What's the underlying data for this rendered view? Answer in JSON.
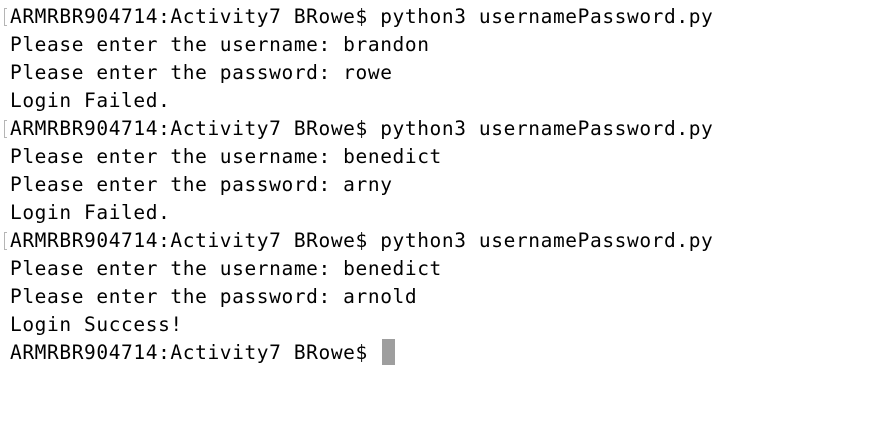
{
  "terminal": {
    "lines": [
      {
        "text": "ARMRBR904714:Activity7 BRowe$ python3 usernamePassword.py",
        "marked": true
      },
      {
        "text": "Please enter the username: brandon",
        "marked": false
      },
      {
        "text": "Please enter the password: rowe",
        "marked": false
      },
      {
        "text": "Login Failed.",
        "marked": false
      },
      {
        "text": "ARMRBR904714:Activity7 BRowe$ python3 usernamePassword.py",
        "marked": true
      },
      {
        "text": "Please enter the username: benedict",
        "marked": false
      },
      {
        "text": "Please enter the password: arny",
        "marked": false
      },
      {
        "text": "Login Failed.",
        "marked": false
      },
      {
        "text": "ARMRBR904714:Activity7 BRowe$ python3 usernamePassword.py",
        "marked": true
      },
      {
        "text": "Please enter the username: benedict",
        "marked": false
      },
      {
        "text": "Please enter the password: arnold",
        "marked": false
      },
      {
        "text": "Login Success!",
        "marked": false
      }
    ],
    "prompt": "ARMRBR904714:Activity7 BRowe$ "
  },
  "colors": {
    "background": "#ffffff",
    "text": "#000000",
    "cursor": "#9e9e9e",
    "mark": "#b5b5b5"
  }
}
